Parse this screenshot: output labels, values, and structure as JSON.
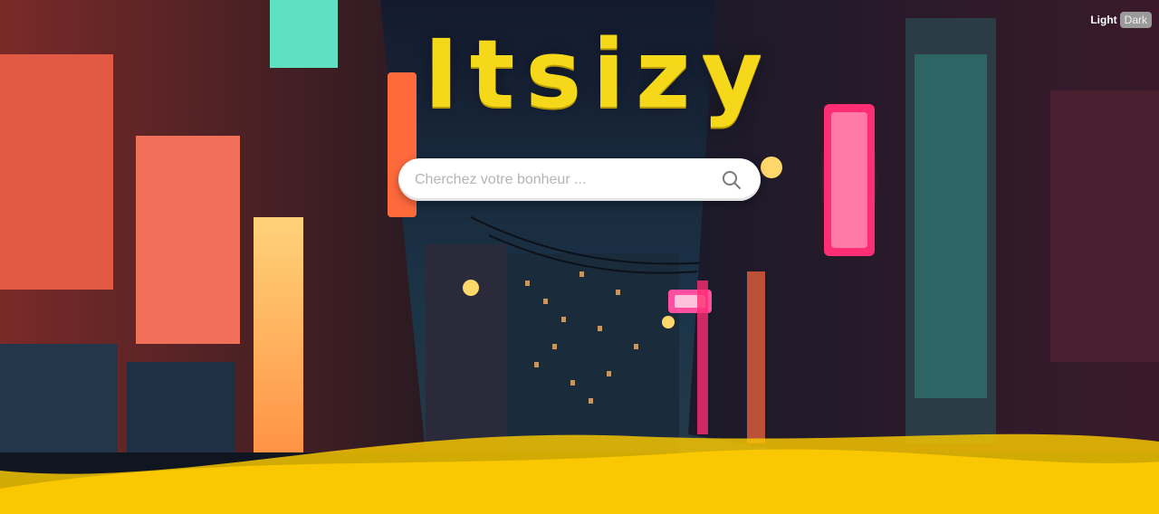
{
  "brand": {
    "logo": "Itsizy"
  },
  "search": {
    "placeholder": "Cherchez votre bonheur ...",
    "value": ""
  },
  "theme": {
    "light_label": "Light",
    "dark_label": "Dark"
  },
  "colors": {
    "accent": "#f5d81a",
    "wave": "#f9c800",
    "neon_pink": "#ff2d73",
    "neon_orange": "#ff6a3d"
  },
  "icons": {
    "search": "search-icon",
    "background": "city-alley-illustration"
  }
}
